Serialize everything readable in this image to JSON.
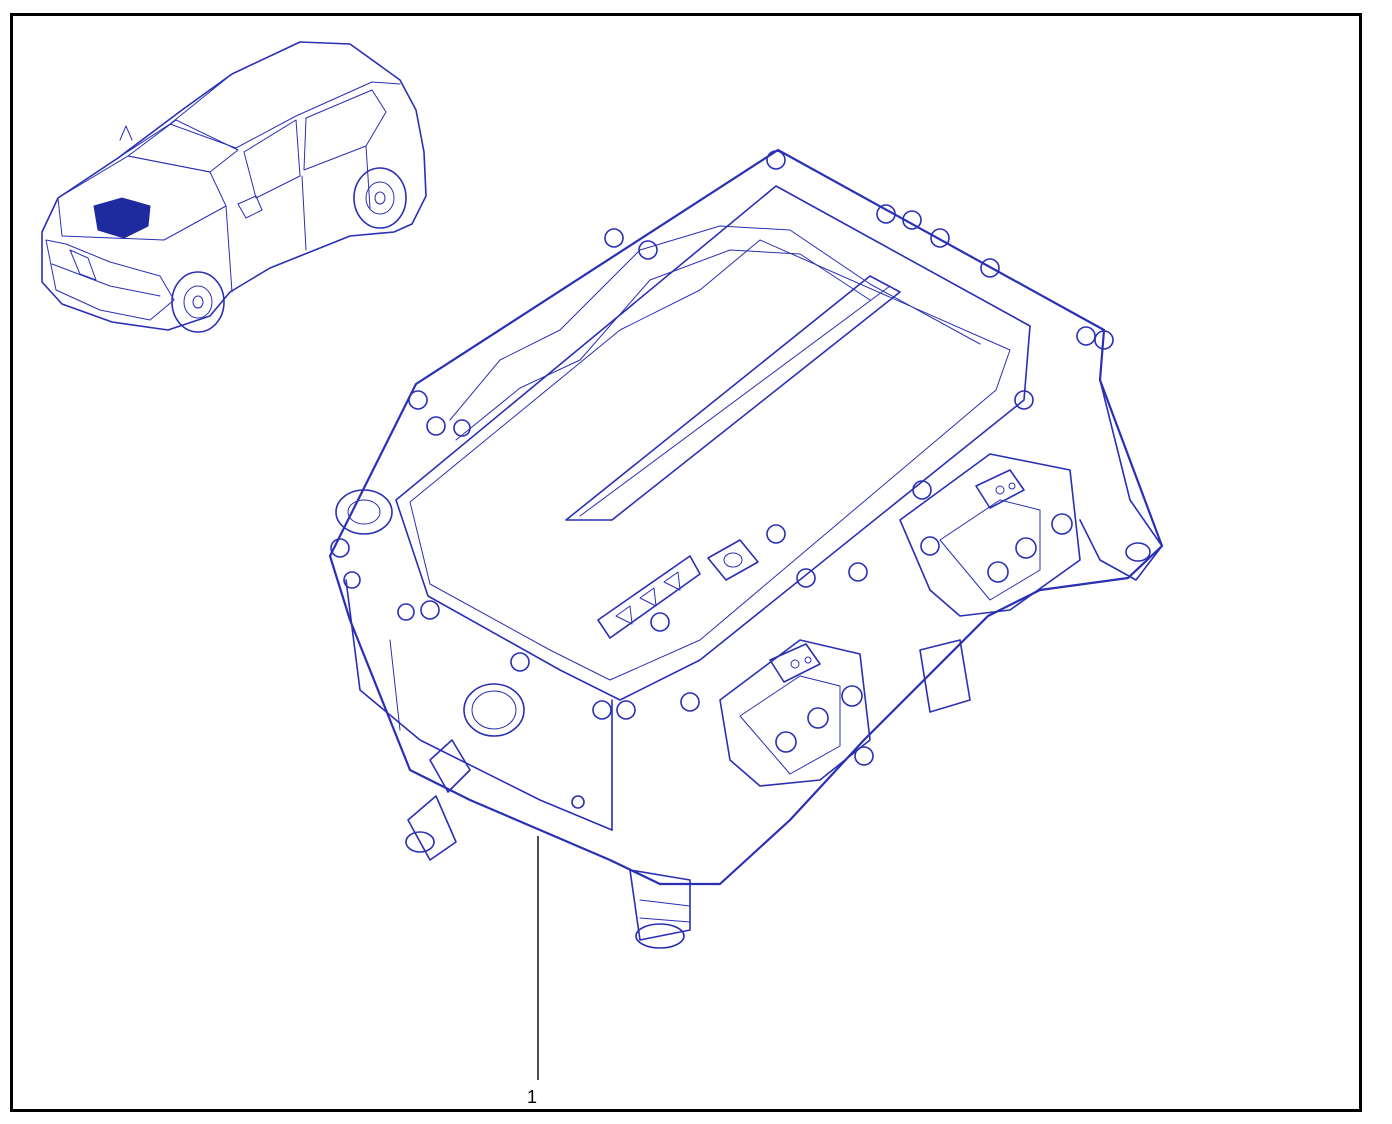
{
  "diagram": {
    "callouts": [
      {
        "label": "1"
      }
    ],
    "colors": {
      "line_art": "#2a2fb5",
      "highlight": "#1e2a9e",
      "frame": "#000000",
      "leader": "#000000"
    },
    "icons": {
      "vehicle": "suv-location-icon",
      "part": "power-electronics-unit-icon"
    }
  }
}
